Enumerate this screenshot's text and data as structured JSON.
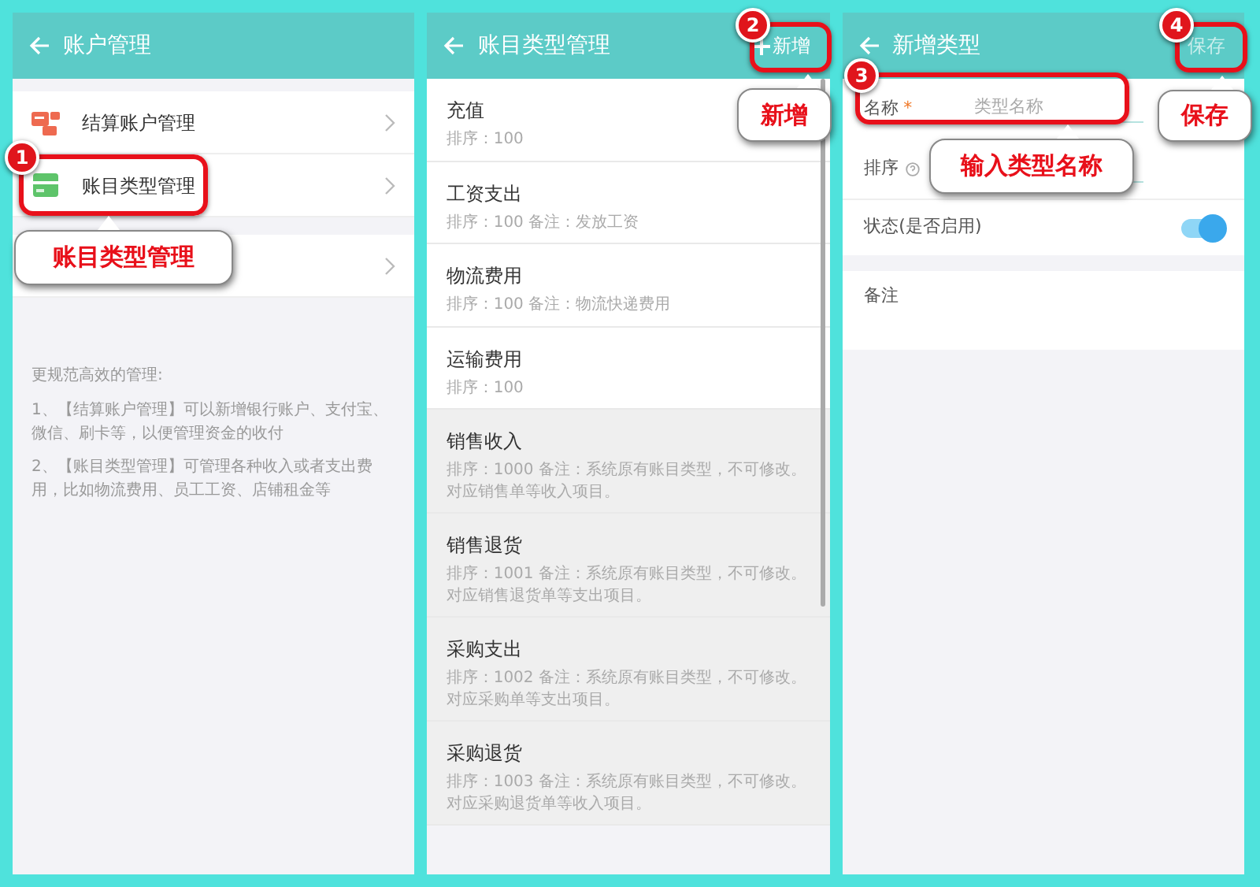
{
  "panels": [
    {
      "kind": "menu",
      "title": "账户管理",
      "groups": [
        {
          "items": [
            {
              "label": "结算账户管理",
              "kind": "account"
            },
            {
              "label": "账目类型管理",
              "kind": "card"
            }
          ]
        },
        {
          "items": [
            {
              "kind": "blank"
            }
          ]
        }
      ],
      "help": {
        "heading": "更规范高效的管理:",
        "lines": [
          "1、【结算账户管理】可以新增银行账户、支付宝、微信、刷卡等，以便管理资金的收付",
          "2、【账目类型管理】可管理各种收入或者支出费用，比如物流费用、员工工资、店铺租金等"
        ]
      }
    },
    {
      "kind": "list",
      "title": "账目类型管理",
      "action": "新增",
      "action_enabled": true,
      "items": [
        {
          "name": "充值",
          "detail": "排序：100",
          "system": false
        },
        {
          "name": "工资支出",
          "detail": "排序：100 备注：发放工资",
          "system": false
        },
        {
          "name": "物流费用",
          "detail": "排序：100 备注：物流快递费用",
          "system": false
        },
        {
          "name": "运输费用",
          "detail": "排序：100",
          "system": false
        },
        {
          "name": "销售收入",
          "detail": "排序：1000 备注：系统原有账目类型，不可修改。对应销售单等收入项目。",
          "system": true
        },
        {
          "name": "销售退货",
          "detail": "排序：1001 备注：系统原有账目类型，不可修改。对应销售退货单等支出项目。",
          "system": true
        },
        {
          "name": "采购支出",
          "detail": "排序：1002 备注：系统原有账目类型，不可修改。对应采购单等支出项目。",
          "system": true
        },
        {
          "name": "采购退货",
          "detail": "排序：1003 备注：系统原有账目类型，不可修改。对应采购退货单等收入项目。",
          "system": true
        }
      ]
    },
    {
      "kind": "form",
      "title": "新增类型",
      "action": "保存",
      "action_enabled": false,
      "fields": [
        {
          "kind": "text",
          "label": "名称",
          "mark": "*",
          "placeholder": "类型名称",
          "help": false
        },
        {
          "kind": "text",
          "label": "排序",
          "help": true
        },
        {
          "kind": "switch",
          "label": "状态(是否启用)",
          "on": true
        },
        {
          "kind": "textarea",
          "label": "备注"
        }
      ]
    }
  ],
  "callouts": [
    {
      "number": "1",
      "text": "账目类型管理"
    },
    {
      "number": "2",
      "text": "新增"
    },
    {
      "number": "3",
      "text": "输入类型名称"
    },
    {
      "number": "4",
      "text": "保存"
    }
  ]
}
